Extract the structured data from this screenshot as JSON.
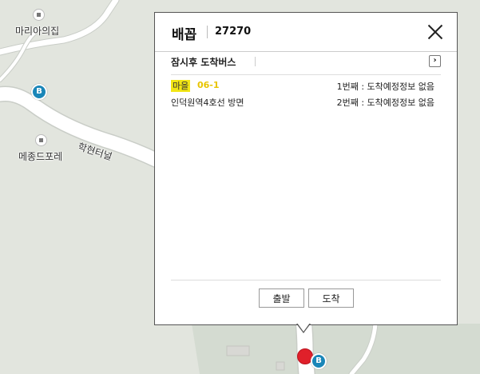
{
  "map": {
    "poi_1": "마리아의집",
    "poi_2": "메종드포레",
    "road_name": "학현터널",
    "bus_badge_label": "B",
    "colors": {
      "road": "#ffffff",
      "ground": "#dfe3dd",
      "bus_badge": "#1a86b8",
      "marker": "#e0202a"
    }
  },
  "popup": {
    "stop_name": "배꼽",
    "stop_id": "27270",
    "close_icon": "close-icon",
    "section_title": "잠시후 도착버스",
    "next_icon": "chevron-right-icon",
    "next_glyph": "›",
    "routes": [
      {
        "type_label": "마을",
        "number": "06-1",
        "direction": "인덕원역4호선 방면",
        "first_arrival": "1번째 : 도착예정정보 없음",
        "second_arrival": "2번째 : 도착예정정보 없음"
      }
    ],
    "buttons": {
      "depart": "출발",
      "arrive": "도착"
    },
    "colors": {
      "route_type_bg": "#f2e614",
      "route_number": "#e8c400"
    }
  }
}
